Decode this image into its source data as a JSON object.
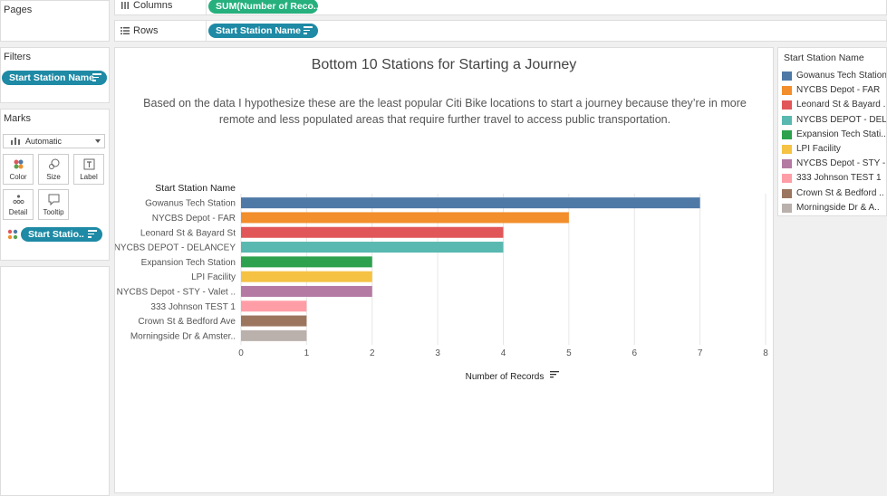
{
  "left": {
    "pages_label": "Pages",
    "filters_label": "Filters",
    "filter_pill": "Start Station Name",
    "marks_label": "Marks",
    "mark_type": "Automatic",
    "mark_buttons": [
      "Color",
      "Size",
      "Label",
      "Detail",
      "Tooltip"
    ],
    "color_pill": "Start Statio.."
  },
  "shelves": {
    "columns_label": "Columns",
    "columns_pill": "SUM(Number of Reco..",
    "rows_label": "Rows",
    "rows_pill": "Start Station Name"
  },
  "colors": {
    "accent_blue": "#1e8aa5",
    "accent_green": "#26b07d"
  },
  "chart_data": {
    "type": "bar",
    "orientation": "horizontal",
    "title": "Bottom 10 Stations for Starting a Journey",
    "subtitle_line1": "Based on the data I hypothesize these are the least popular Citi Bike locations to start a journey because they’re in more",
    "subtitle_line2": "remote and less populated areas that require further travel to access public transportation.",
    "ylabel": "Start Station Name",
    "xlabel": "Number of Records",
    "categories": [
      "Gowanus Tech Station",
      "NYCBS Depot - FAR",
      "Leonard St & Bayard St",
      "NYCBS DEPOT - DELANCEY",
      "Expansion Tech Station",
      "LPI Facility",
      "NYCBS Depot - STY - Valet ..",
      "333 Johnson TEST 1",
      "Crown St & Bedford Ave",
      "Morningside Dr & Amster.."
    ],
    "values": [
      7,
      5,
      4,
      4,
      2,
      2,
      2,
      1,
      1,
      1
    ],
    "bar_colors": [
      "#4e79a7",
      "#f28e2b",
      "#e15759",
      "#59b8b0",
      "#2da14d",
      "#f5c243",
      "#b47aa3",
      "#ff9da7",
      "#9c755f",
      "#bab0ac"
    ],
    "xlim": [
      0,
      8
    ],
    "xticks": [
      "0",
      "1",
      "2",
      "3",
      "4",
      "5",
      "6",
      "7",
      "8"
    ],
    "grid": true
  },
  "legend": {
    "title": "Start Station Name",
    "items": [
      "Gowanus Tech Station",
      "NYCBS Depot - FAR",
      "Leonard St & Bayard ..",
      "NYCBS DEPOT - DELA..",
      "Expansion Tech Stati..",
      "LPI Facility",
      "NYCBS Depot - STY - ..",
      "333 Johnson TEST 1",
      "Crown St & Bedford ..",
      "Morningside Dr & A.."
    ]
  }
}
